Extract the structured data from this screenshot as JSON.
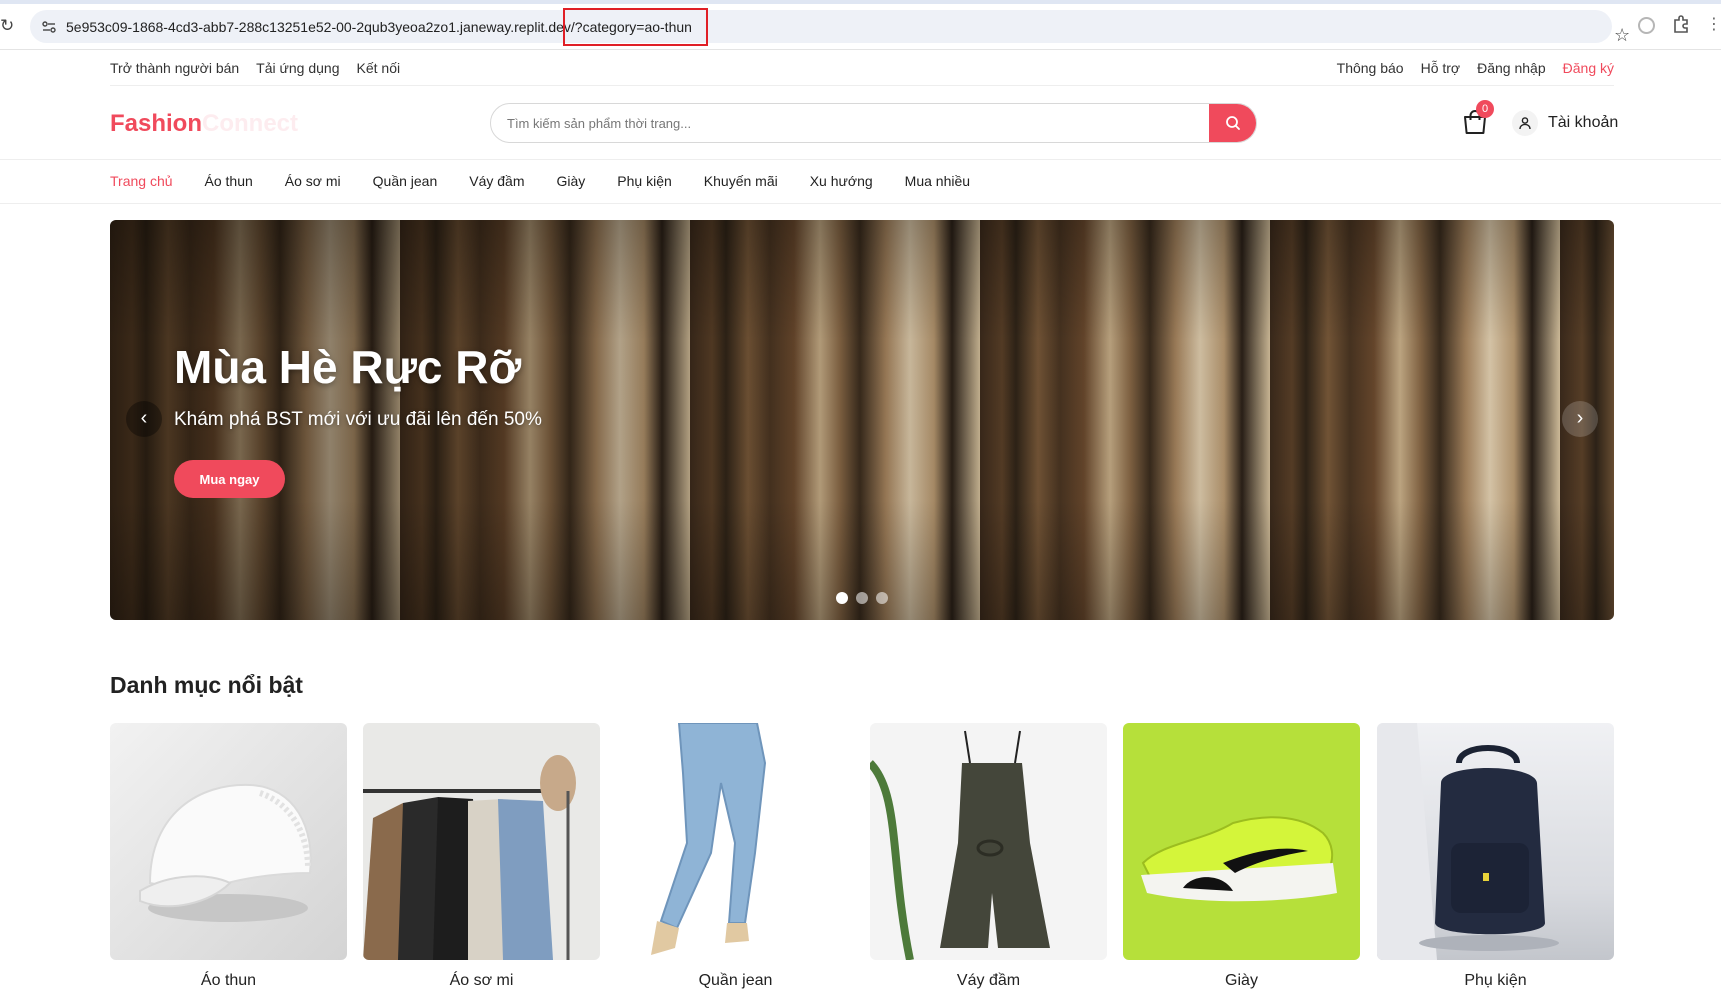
{
  "browser": {
    "url": "5e953c09-1868-4cd3-abb7-288c13251e52-00-2qub3yeoa2zo1.janeway.replit.dev/?category=ao-thun"
  },
  "topbar": {
    "left": [
      "Trở thành người bán",
      "Tải ứng dụng",
      "Kết nối"
    ],
    "right": [
      "Thông báo",
      "Hỗ trợ",
      "Đăng nhập",
      "Đăng ký"
    ]
  },
  "header": {
    "logo_part1": "Fashion",
    "logo_part2": "Connect",
    "search_placeholder": "Tìm kiếm sản phẩm thời trang...",
    "cart_count": "0",
    "account_label": "Tài khoản"
  },
  "nav": {
    "items": [
      "Trang chủ",
      "Áo thun",
      "Áo sơ mi",
      "Quần jean",
      "Váy đầm",
      "Giày",
      "Phụ kiện",
      "Khuyến mãi",
      "Xu hướng",
      "Mua nhiều"
    ],
    "active_index": 0
  },
  "hero": {
    "title": "Mùa Hè Rực Rỡ",
    "subtitle": "Khám phá BST mới với ưu đãi lên đến 50%",
    "cta": "Mua ngay",
    "slide_count": 3,
    "active_slide": 0
  },
  "categories": {
    "title": "Danh mục nổi bật",
    "items": [
      {
        "label": "Áo thun"
      },
      {
        "label": "Áo sơ mi"
      },
      {
        "label": "Quần jean"
      },
      {
        "label": "Váy đầm"
      },
      {
        "label": "Giày"
      },
      {
        "label": "Phụ kiện"
      }
    ]
  },
  "colors": {
    "accent": "#f04a5c",
    "highlight_box": "#e01f26",
    "shoe_bg": "#b6e03a"
  }
}
